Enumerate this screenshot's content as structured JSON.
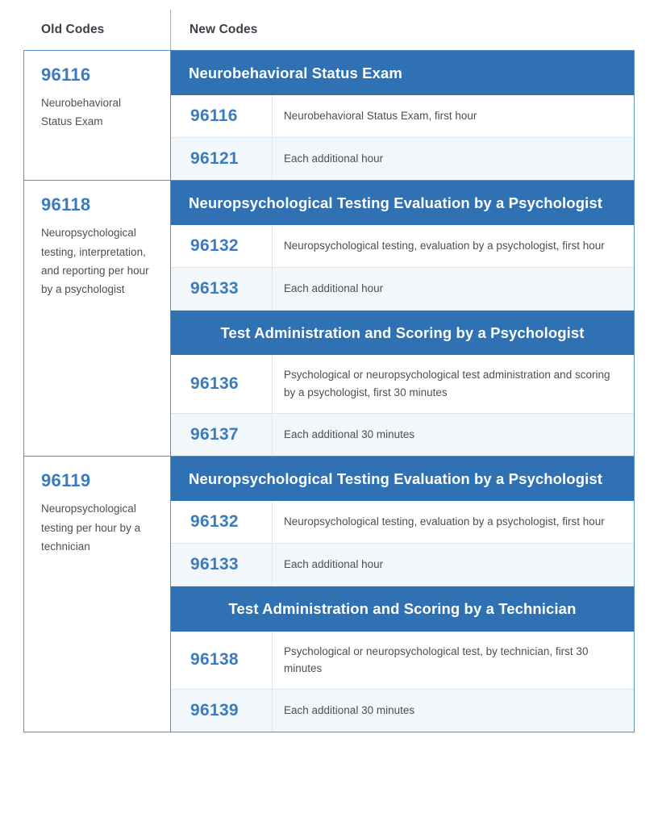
{
  "table": {
    "column_headers": {
      "old": "Old Codes",
      "new": "New Codes"
    },
    "accent_color": "#2f71b3",
    "code_color": "#3b7cbe",
    "alt_row_color": "#f2f7fb",
    "border_color": "#5b92c6",
    "groups": [
      {
        "old_code": "96116",
        "old_desc": "Neurobehavioral Status Exam",
        "sections": [
          {
            "heading": "Neurobehavioral Status Exam",
            "heading_align": "left",
            "rows": [
              {
                "code": "96116",
                "desc": "Neurobehavioral Status Exam, first hour"
              },
              {
                "code": "96121",
                "desc": "Each additional hour"
              }
            ]
          }
        ]
      },
      {
        "old_code": "96118",
        "old_desc": "Neuropsychological testing, interpretation, and reporting per hour by a psychologist",
        "sections": [
          {
            "heading": "Neuropsychological Testing Evaluation by a Psychologist",
            "heading_align": "left",
            "rows": [
              {
                "code": "96132",
                "desc": "Neuropsychological testing, evaluation by a psychologist, first hour"
              },
              {
                "code": "96133",
                "desc": "Each additional hour"
              }
            ]
          },
          {
            "heading": "Test Administration and Scoring by a Psychologist",
            "heading_align": "center",
            "rows": [
              {
                "code": "96136",
                "desc": "Psychological or neuropsychological test administration and scoring by a psychologist, first 30 minutes"
              },
              {
                "code": "96137",
                "desc": "Each additional 30 minutes"
              }
            ]
          }
        ]
      },
      {
        "old_code": "96119",
        "old_desc": "Neuropsychological testing per hour by a technician",
        "sections": [
          {
            "heading": "Neuropsychological Testing Evaluation by a Psychologist",
            "heading_align": "left",
            "rows": [
              {
                "code": "96132",
                "desc": "Neuropsychological testing, evaluation by a psychologist, first hour"
              },
              {
                "code": "96133",
                "desc": "Each additional hour"
              }
            ]
          },
          {
            "heading": "Test Administration and Scoring by a Technician",
            "heading_align": "center",
            "rows": [
              {
                "code": "96138",
                "desc": "Psychological or neuropsychological test, by technician, first 30 minutes"
              },
              {
                "code": "96139",
                "desc": "Each additional 30 minutes"
              }
            ]
          }
        ]
      }
    ]
  }
}
